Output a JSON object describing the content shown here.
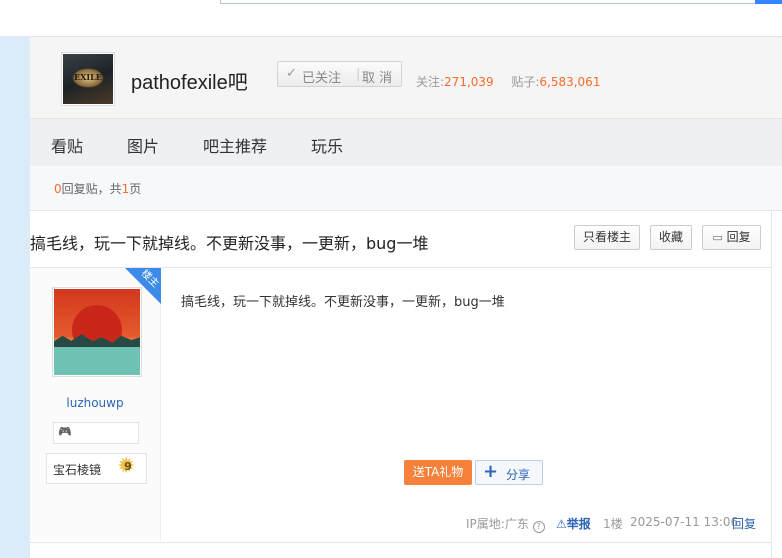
{
  "forum": {
    "name": "pathofexile吧",
    "avatar_text": "EXILE",
    "follow_label": "已关注",
    "unfollow_label": "取 消",
    "followers_label": "关注:",
    "followers": "271,039",
    "posts_label": "贴子:",
    "posts": "6,583,061"
  },
  "nav": {
    "items": [
      "看贴",
      "图片",
      "吧主推荐",
      "玩乐"
    ]
  },
  "reply_bar": {
    "count": "0",
    "mid": "回复贴，共",
    "pages": "1",
    "suffix": "页"
  },
  "thread": {
    "title": "搞毛线，玩一下就掉线。不更新没事，一更新，bug一堆",
    "btn_only_op": "只看楼主",
    "btn_fav": "收藏",
    "btn_reply": "回复"
  },
  "post": {
    "op_badge": "楼主",
    "username": "luzhouwp",
    "level_name": "宝石棱镜",
    "level_num": "9",
    "content": "搞毛线，玩一下就掉线。不更新没事，一更新，bug一堆",
    "gift_label": "送TA礼物",
    "share_label": "分享",
    "ip_label": "IP属地:广东",
    "report_label": "举报",
    "floor": "1楼",
    "time": "2025-07-11 13:06",
    "reply_link": "回复"
  },
  "colors": {
    "accent_orange": "#f76b2c",
    "link_blue": "#2d64b3",
    "badge_blue": "#3d8be8"
  }
}
